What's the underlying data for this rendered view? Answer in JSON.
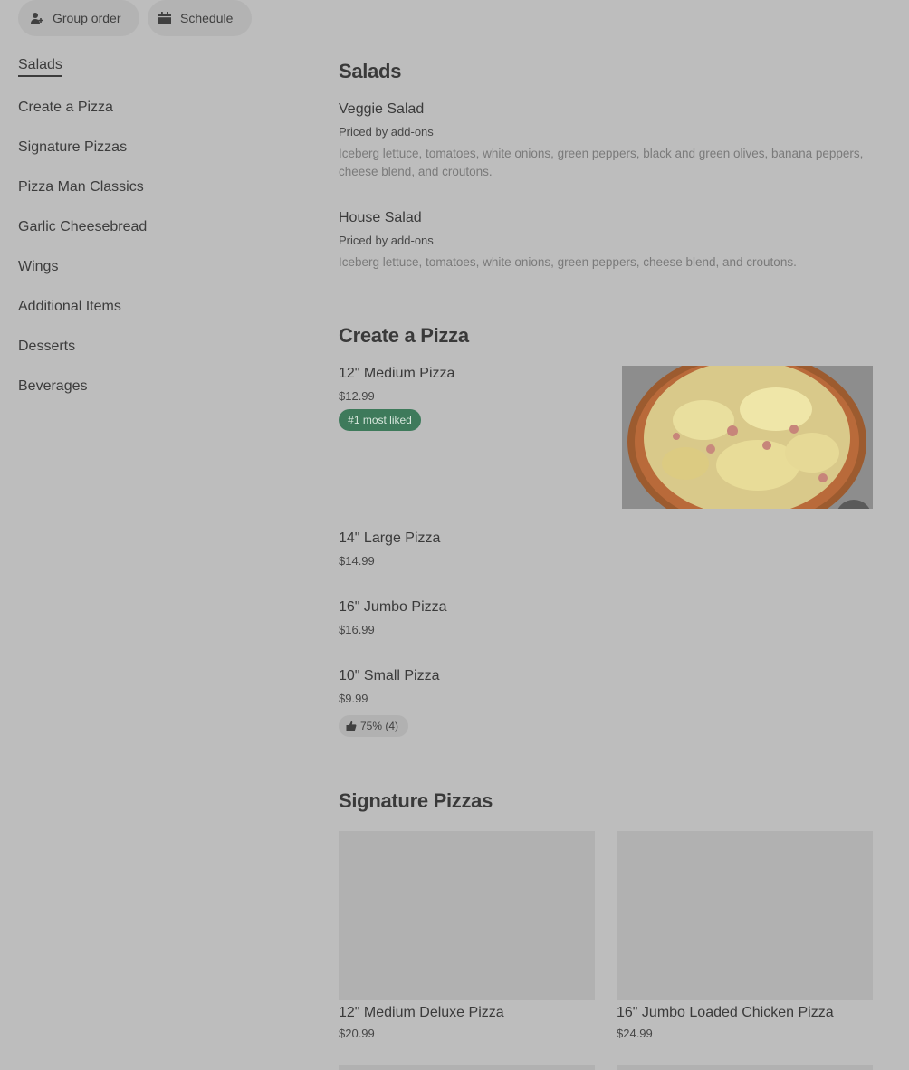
{
  "top_actions": {
    "group_order": "Group order",
    "schedule": "Schedule"
  },
  "sidebar": {
    "items": [
      {
        "label": "Salads"
      },
      {
        "label": "Create a Pizza"
      },
      {
        "label": "Signature Pizzas"
      },
      {
        "label": "Pizza Man Classics"
      },
      {
        "label": "Garlic Cheesebread"
      },
      {
        "label": "Wings"
      },
      {
        "label": "Additional Items"
      },
      {
        "label": "Desserts"
      },
      {
        "label": "Beverages"
      }
    ]
  },
  "sections": {
    "salads": {
      "title": "Salads",
      "items": [
        {
          "name": "Veggie Salad",
          "price": "Priced by add-ons",
          "desc": "Iceberg lettuce, tomatoes, white onions, green peppers, black and green olives, banana peppers, cheese blend, and croutons."
        },
        {
          "name": "House Salad",
          "price": "Priced by add-ons",
          "desc": "Iceberg lettuce, tomatoes, white onions, green peppers, cheese blend, and croutons."
        }
      ]
    },
    "create_pizza": {
      "title": "Create a Pizza",
      "items": [
        {
          "name": "12\" Medium Pizza",
          "price": "$12.99",
          "badge": "#1 most liked"
        },
        {
          "name": "14\" Large Pizza",
          "price": "$14.99"
        },
        {
          "name": "16\" Jumbo Pizza",
          "price": "$16.99"
        },
        {
          "name": "10\" Small Pizza",
          "price": "$9.99",
          "rating": "75% (4)"
        }
      ]
    },
    "signature": {
      "title": "Signature Pizzas",
      "items": [
        {
          "name": "12\" Medium Deluxe Pizza",
          "price": "$20.99"
        },
        {
          "name": "16\" Jumbo Loaded Chicken Pizza",
          "price": "$24.99"
        }
      ]
    }
  },
  "colors": {
    "background": "#bdbdbd",
    "badge_green": "#3e7a5b"
  }
}
